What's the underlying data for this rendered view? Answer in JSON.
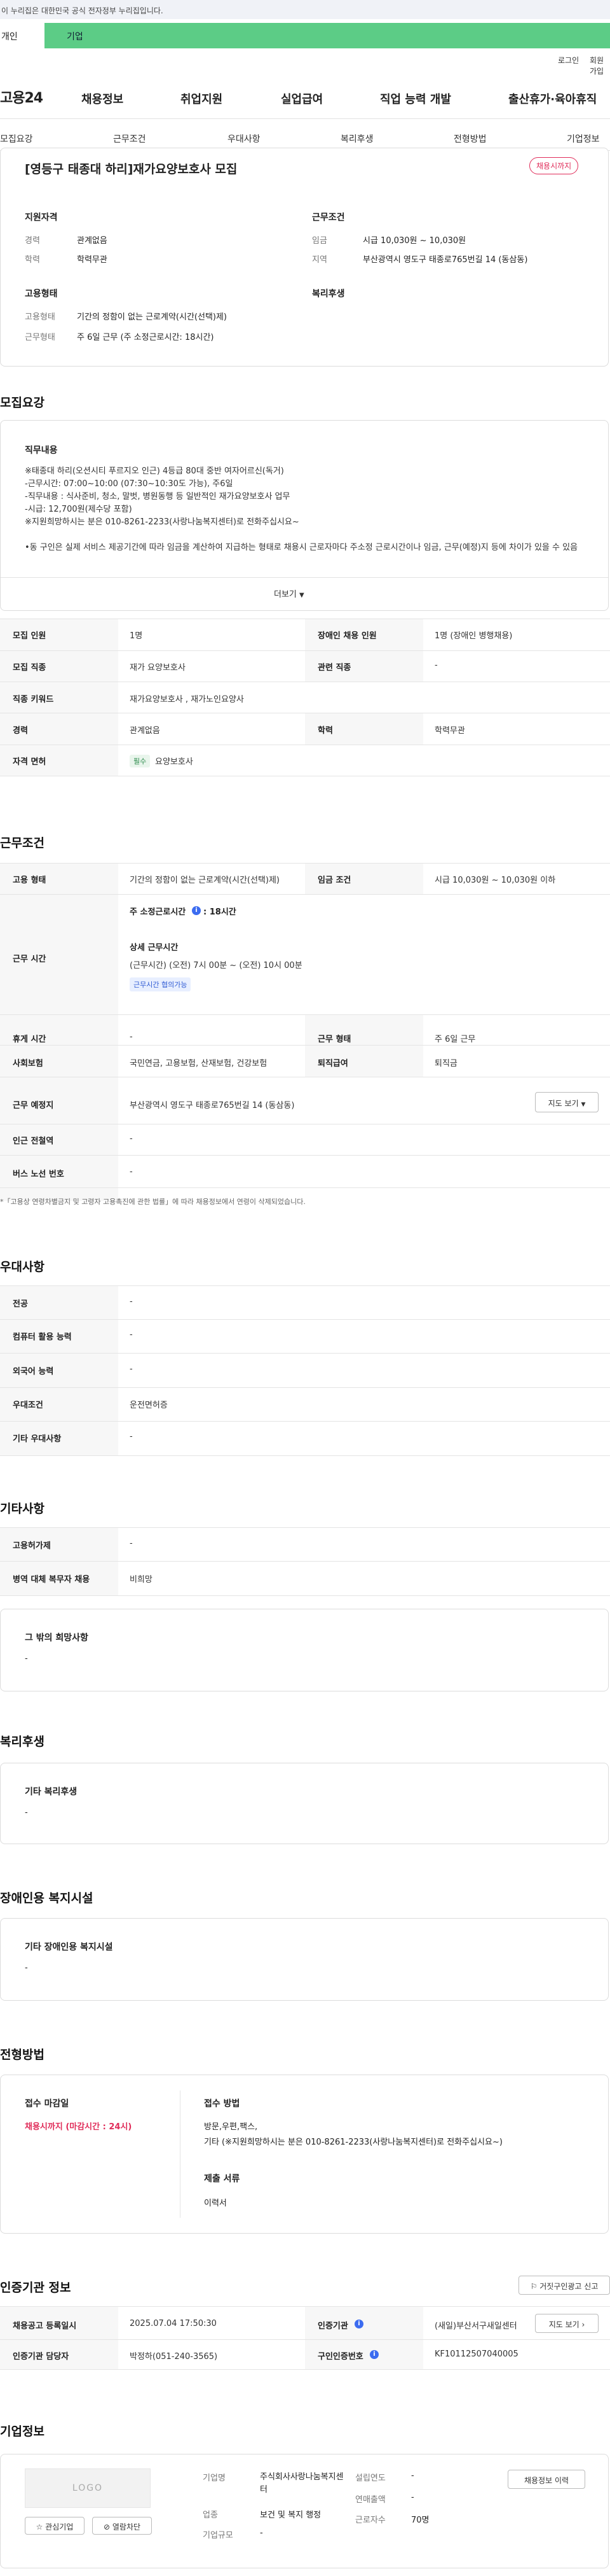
{
  "gov_banner": "이 누리집은 대한민국 공식 전자정부 누리집입니다.",
  "tabs": {
    "person": "개인",
    "company": "기업"
  },
  "util": {
    "login": "로그인",
    "join": "회원가입"
  },
  "logo": "고용24",
  "gnb": [
    "채용정보",
    "취업지원",
    "실업급여",
    "직업 능력 개발",
    "출산휴가·육아휴직"
  ],
  "subnav": [
    "모집요강",
    "근무조건",
    "우대사항",
    "복리후생",
    "전형방법",
    "기업정보"
  ],
  "summary": {
    "title": "[영등구 태종대 하리]재가요양보호사 모집",
    "badge": "채용시까지",
    "qual_title": "지원자격",
    "cond_title": "근무조건",
    "emp_title": "고용형태",
    "welfare_title": "복리후생",
    "career_label": "경력",
    "career_value": "관계없음",
    "edu_label": "학력",
    "edu_value": "학력무관",
    "wage_label": "임금",
    "wage_value": "시급 10,030원 ~ 10,030원",
    "region_label": "지역",
    "region_value": "부산광역시 영도구 태종로765번길 14 (동삼동)",
    "emptype_label": "고용형태",
    "emptype_value": "기간의 정함이 없는 근로계약(시간(선택)제)",
    "worktype_label": "근무형태",
    "worktype_value": "주 6일 근무 (주 소정근로시간: 18시간)"
  },
  "recruit": {
    "title": "모집요강",
    "job_title": "직무내용",
    "job_desc": "※태종대 하리(오션시티 푸르지오 인근) 4등급 80대 중반 여자어르신(독거)\n-근무시간: 07:00~10:00 (07:30~10:30도 가능), 주6일\n-직무내용 : 식사준비, 청소, 말벗, 병원동행 등 일반적인 재가요양보호사 업무\n-시급: 12,700원(제수당 포함)\n※지원희망하시는 분은 010-8261-2233(사랑나눔복지센터)로 전화주십시요~\n\n•동 구인은 실제 서비스 제공기간에 따라 임금을 계산하여 지급하는 형태로 채용시 근로자마다 주소정 근로시간이나 임금, 근무(예정)지 등에 차이가 있을 수 있음",
    "more": "더보기",
    "rows": [
      {
        "k1": "모집 인원",
        "v1": "1명",
        "k2": "장애인 채용 인원",
        "v2": "1명 (장애인 병행채용)"
      },
      {
        "k1": "모집 직종",
        "v1": "재가 요양보호사",
        "k2": "관련 직종",
        "v2": "-"
      },
      {
        "k1": "직종 키워드",
        "v1": "재가요양보호사 , 재가노인요양사"
      },
      {
        "k1": "경력",
        "v1": "관계없음",
        "k2": "학력",
        "v2": "학력무관"
      },
      {
        "k1": "자격 면허",
        "chip": "필수",
        "v1": "요양보호사"
      }
    ]
  },
  "conditions": {
    "title": "근무조건",
    "emptype_k": "고용 형태",
    "emptype_v": "기간의 정함이 없는 근로계약(시간(선택)제)",
    "wage_k": "임금 조건",
    "wage_v": "시급 10,030원 ~ 10,030원 이하",
    "hours_k": "근무 시간",
    "hours_week": "주 소정근로시간",
    "hours_week_v": ": 18시간",
    "hours_detail_title": "상세 근무시간",
    "hours_detail": "(근무시간) (오전) 7시 00분 ~ (오전) 10시 00분",
    "hours_chip": "근무시간 협의가능",
    "rest_k": "휴게 시간",
    "rest_v": "-",
    "form_k": "근무 형태",
    "form_v": "주 6일 근무",
    "insurance_k": "사회보험",
    "insurance_v": "국민연금, 고용보험, 산재보험, 건강보험",
    "severance_k": "퇴직급여",
    "severance_v": "퇴직금",
    "place_k": "근무 예정지",
    "place_v": "부산광역시 영도구 태종로765번길 14 (동삼동)",
    "map_btn": "지도 보기",
    "subway_k": "인근 전철역",
    "subway_v": "-",
    "bus_k": "버스 노선 번호",
    "bus_v": "-",
    "note": "*「고용상 연령차별금지 및 고령자 고용촉진에 관한 법률」에 따라 채용정보에서 연령이 삭제되었습니다."
  },
  "preference": {
    "title": "우대사항",
    "rows": [
      {
        "k": "전공",
        "v": "-"
      },
      {
        "k": "컴퓨터 활용 능력",
        "v": "-"
      },
      {
        "k": "외국어 능력",
        "v": "-"
      },
      {
        "k": "우대조건",
        "v": "운전면허증"
      },
      {
        "k": "기타 우대사항",
        "v": "-"
      }
    ]
  },
  "etc": {
    "title": "기타사항",
    "rows": [
      {
        "k": "고용허가제",
        "v": "-"
      },
      {
        "k": "병역 대체 복무자 채용",
        "v": "비희망"
      }
    ],
    "other_title": "그 밖의 희망사항",
    "other_value": "-"
  },
  "welfare": {
    "title": "복리후생",
    "sub": "기타 복리후생",
    "value": "-"
  },
  "disability": {
    "title": "장애인용 복지시설",
    "sub": "기타 장애인용 복지시설",
    "value": "-"
  },
  "selection": {
    "title": "전형방법",
    "deadline_title": "접수 마감일",
    "deadline_value": "채용시까지 (마감시간 : 24시)",
    "method_title": "접수 방법",
    "method_value": "방문,우편,팩스,",
    "method_etc": "기타 (※지원희망하시는 분은 010-8261-2233(사랑나눔복지센터)로 전화주십시요~)",
    "docs_title": "제출 서류",
    "docs_value": "이력서"
  },
  "cert": {
    "title": "인증기관 정보",
    "share_btn": "거짓구인광고 신고",
    "reg_k": "채용공고 등록일시",
    "reg_v": "2025.07.04 17:50:30",
    "agency_k": "인증기관",
    "agency_v": "(새일)부산서구새일센터",
    "map_btn": "지도 보기",
    "manager_k": "인증기관 담당자",
    "manager_v": "박정하(051-240-3565)",
    "number_k": "구인인증번호",
    "number_v": "KF10112507040005"
  },
  "company": {
    "title": "기업정보",
    "logo_text": "LOGO",
    "interest_btn": "관심기업",
    "block_btn": "열람차단",
    "name_k": "기업명",
    "name_v": "주식회사사랑나눔복지센터",
    "year_k": "설립연도",
    "year_v": "-",
    "sales_k": "연매출액",
    "sales_v": "-",
    "industry_k": "업종",
    "industry_v": "보건 및 복지 행정",
    "staff_k": "근로자수",
    "staff_v": "70명",
    "size_k": "기업규모",
    "size_v": "-",
    "history_btn": "채용정보 이력"
  },
  "colors": {
    "accent_green": "#5ccc86",
    "badge_red": "#e02d5a",
    "info_blue": "#3c6cf0"
  }
}
